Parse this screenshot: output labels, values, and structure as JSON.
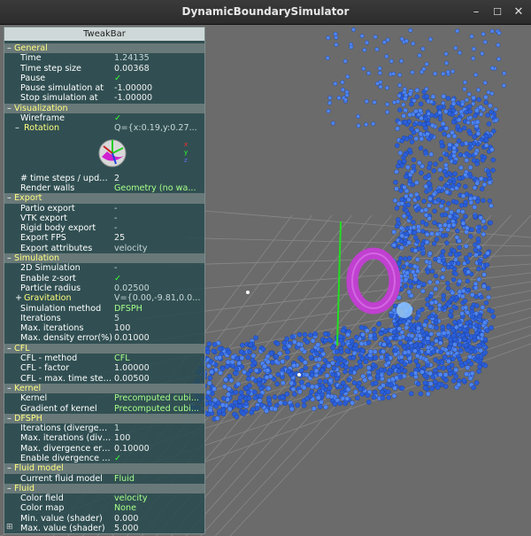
{
  "window": {
    "title": "DynamicBoundarySimulator",
    "buttons": {
      "minimize": "–",
      "maximize": "☐",
      "close": "✕"
    }
  },
  "tweakbar": {
    "title": "TweakBar",
    "rotation_widget": {
      "axis_letters": [
        "x",
        "y",
        "z"
      ]
    },
    "corner_icon": "⊞",
    "groups": [
      {
        "name": "General",
        "items": [
          {
            "label": "Time",
            "value": "1.24135",
            "type": "ro"
          },
          {
            "label": "Time step size",
            "value": "0.00368",
            "type": "rw"
          },
          {
            "label": "Pause",
            "value": "✓",
            "type": "check"
          },
          {
            "label": "Pause simulation at",
            "value": "-1.00000",
            "type": "rw"
          },
          {
            "label": "Stop simulation at",
            "value": "-1.00000",
            "type": "rw"
          }
        ]
      },
      {
        "name": "Visualization",
        "items": [
          {
            "label": "Wireframe",
            "value": "✓",
            "type": "check"
          },
          {
            "label": "Rotation",
            "value": "Q={x:0.19,y:0.27...",
            "type": "sub"
          },
          {
            "label": "",
            "value": "",
            "type": "widget"
          },
          {
            "label": "# time steps / update",
            "value": "2",
            "type": "rw"
          },
          {
            "label": "Render walls",
            "value": "Geometry (no wa...",
            "type": "enum"
          }
        ]
      },
      {
        "name": "Export",
        "items": [
          {
            "label": "Partio export",
            "value": "-",
            "type": "dash"
          },
          {
            "label": "VTK export",
            "value": "-",
            "type": "dash"
          },
          {
            "label": "Rigid body export",
            "value": "-",
            "type": "dash"
          },
          {
            "label": "Export FPS",
            "value": "25",
            "type": "rw"
          },
          {
            "label": "Export attributes",
            "value": "velocity",
            "type": "ro"
          }
        ]
      },
      {
        "name": "Simulation",
        "items": [
          {
            "label": "2D Simulation",
            "value": "-",
            "type": "dash"
          },
          {
            "label": "Enable z-sort",
            "value": "✓",
            "type": "check"
          },
          {
            "label": "Particle radius",
            "value": "0.02500",
            "type": "ro"
          },
          {
            "label": "Gravitation",
            "value": "V={0.00,-9.81,0.0...",
            "type": "subplus"
          },
          {
            "label": "Simulation method",
            "value": "DFSPH",
            "type": "enum"
          },
          {
            "label": "Iterations",
            "value": "5",
            "type": "ro"
          },
          {
            "label": "Max. iterations",
            "value": "100",
            "type": "rw"
          },
          {
            "label": "Max. density error(%)",
            "value": "0.01000",
            "type": "rw"
          }
        ]
      },
      {
        "name": "CFL",
        "items": [
          {
            "label": "CFL - method",
            "value": "CFL",
            "type": "enum"
          },
          {
            "label": "CFL - factor",
            "value": "1.00000",
            "type": "rw"
          },
          {
            "label": "CFL - max. time step...",
            "value": "0.00500",
            "type": "rw"
          }
        ]
      },
      {
        "name": "Kernel",
        "items": [
          {
            "label": "Kernel",
            "value": "Precomputed cubi...",
            "type": "enum"
          },
          {
            "label": "Gradient of kernel",
            "value": "Precomputed cubi...",
            "type": "enum"
          }
        ]
      },
      {
        "name": "DFSPH",
        "items": [
          {
            "label": "Iterations (divergenc...",
            "value": "1",
            "type": "ro"
          },
          {
            "label": "Max. iterations (dive...",
            "value": "100",
            "type": "rw"
          },
          {
            "label": "Max. divergence erro...",
            "value": "0.10000",
            "type": "rw"
          },
          {
            "label": "Enable divergence so...",
            "value": "✓",
            "type": "check"
          }
        ]
      },
      {
        "name": "Fluid model",
        "items": [
          {
            "label": "Current fluid model",
            "value": "Fluid",
            "type": "enum"
          }
        ]
      },
      {
        "name": "Fluid",
        "items": [
          {
            "label": "Color field",
            "value": "velocity",
            "type": "enum"
          },
          {
            "label": "Color map",
            "value": "None",
            "type": "enum"
          },
          {
            "label": "Min. value (shader)",
            "value": "0.000",
            "type": "rw"
          },
          {
            "label": "Max. value (shader)",
            "value": "5.000",
            "type": "rw"
          }
        ]
      }
    ]
  },
  "colors": {
    "viewport_bg": "#6b6b6b",
    "grid_line": "#888888",
    "particle_blue": "#2a5fd8",
    "particle_light": "#4f86f0",
    "torus": "#c040d0",
    "axis_green": "#22dd22"
  }
}
